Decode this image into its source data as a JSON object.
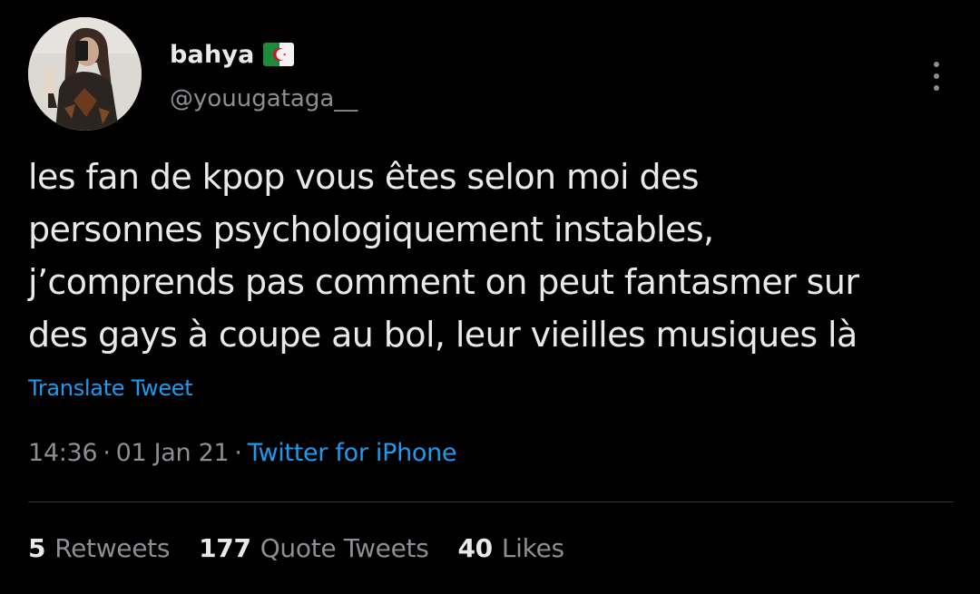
{
  "author": {
    "display_name": "bahya",
    "flag_icon": "algeria-flag-icon",
    "handle": "@youugataga__",
    "avatar_icon": "profile-photo-avatar"
  },
  "tweet": {
    "text": "les fan de kpop vous êtes selon moi des\npersonnes psychologiquement instables,\nj’comprends pas comment on peut fantasmer sur\ndes gays à coupe au bol, leur vieilles musiques là",
    "translate_label": "Translate Tweet",
    "time": "14:36",
    "date": "01 Jan 21",
    "separator": "·",
    "source": "Twitter for iPhone"
  },
  "stats": {
    "retweets_count": "5",
    "retweets_label": "Retweets",
    "quote_tweets_count": "177",
    "quote_tweets_label": "Quote Tweets",
    "likes_count": "40",
    "likes_label": "Likes"
  },
  "colors": {
    "background": "#000000",
    "text": "#e7e9ea",
    "muted": "#8b8f93",
    "link": "#1d9bf0",
    "divider": "#2f3336"
  }
}
